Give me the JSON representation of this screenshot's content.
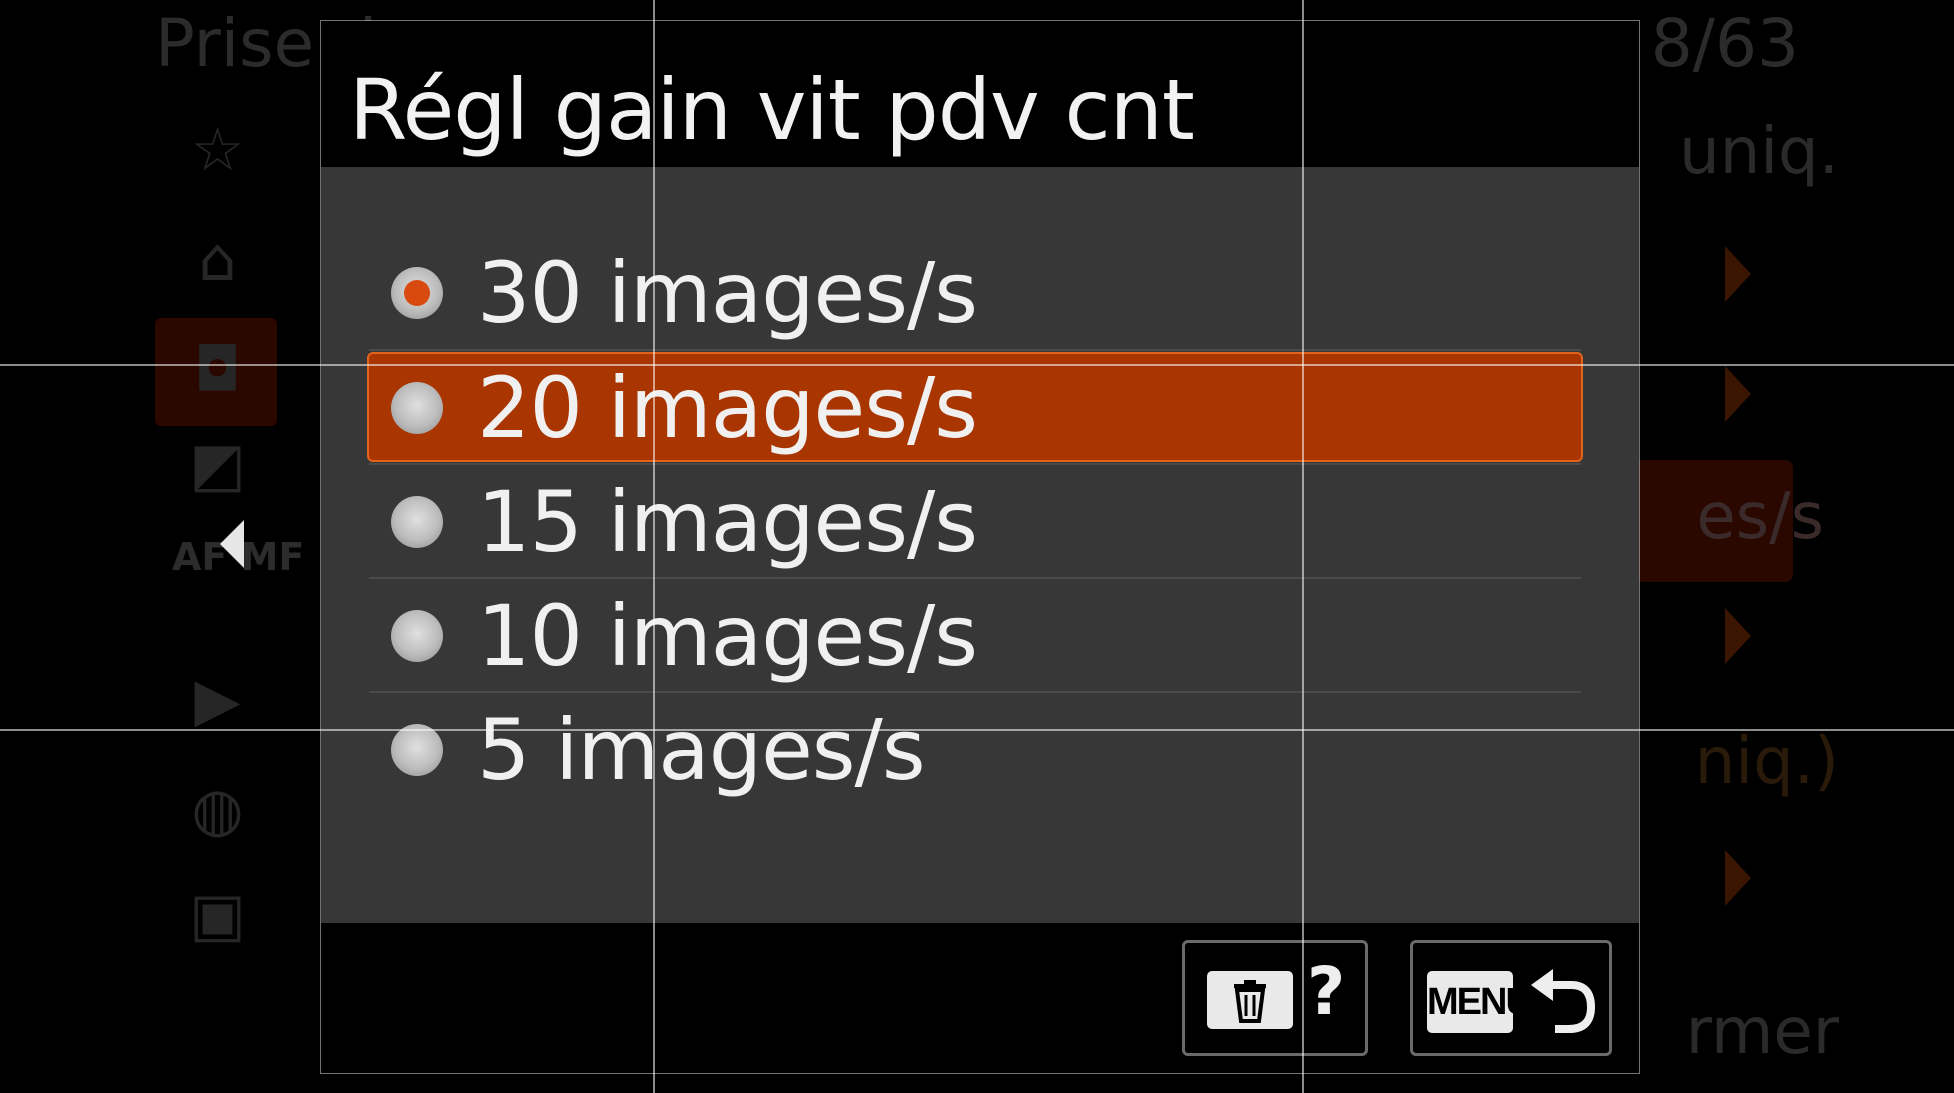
{
  "background": {
    "title": "Prise de vue",
    "page_counter": "8/63",
    "value_uniq": "uniq.",
    "value_sel_suffix": "es/s",
    "value_uniq2": "niq.)",
    "value_bottom": "rmer",
    "afmf": "AF MF"
  },
  "dialog": {
    "title": "Régl gain vit pdv cnt",
    "options": [
      {
        "label": "30 images/s",
        "checked": true
      },
      {
        "label": "20 images/s",
        "focused": true
      },
      {
        "label": "15 images/s"
      },
      {
        "label": "10 images/s"
      },
      {
        "label": "5 images/s"
      }
    ],
    "footer": {
      "help_symbol": "?",
      "menu_label": "MENU"
    }
  },
  "colors": {
    "focus": "#a93500",
    "focus_border": "#e2631c",
    "radio_checked": "#d84a10",
    "panel": "#373737"
  },
  "icons": [
    "star-icon",
    "camera-icon",
    "exposure-icon",
    "play-icon",
    "globe-icon",
    "toolbox-icon",
    "trash-icon",
    "back-arrow-icon",
    "left-arrow-icon"
  ]
}
